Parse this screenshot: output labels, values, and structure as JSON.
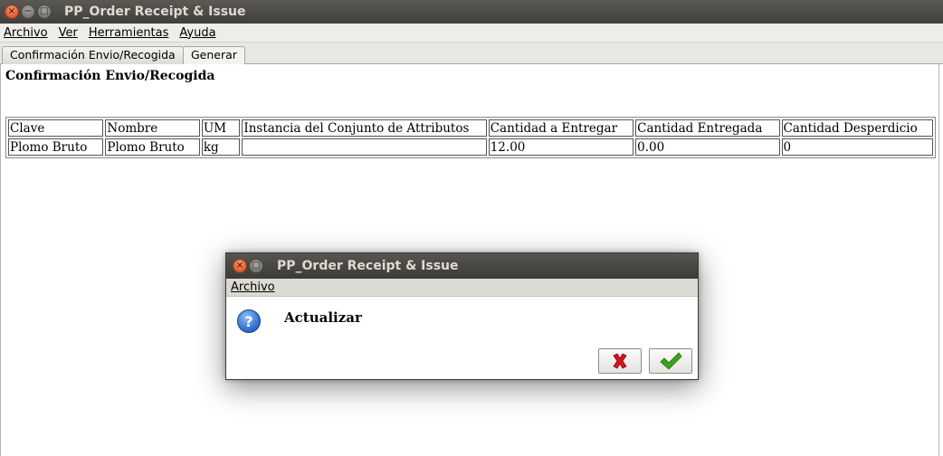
{
  "window": {
    "title": "PP_Order Receipt & Issue"
  },
  "menu": [
    {
      "label": "Archivo"
    },
    {
      "label": "Ver"
    },
    {
      "label": "Herramientas"
    },
    {
      "label": "Ayuda"
    }
  ],
  "tabs": [
    {
      "label": "Confirmación Envio/Recogida",
      "active": false
    },
    {
      "label": "Generar",
      "active": true
    }
  ],
  "section": {
    "title": "Confirmación Envio/Recogida"
  },
  "table": {
    "headers": [
      "Clave",
      "Nombre",
      "UM",
      "Instancia del Conjunto de Attributos",
      "Cantidad a Entregar",
      "Cantidad Entregada",
      "Cantidad Desperdicio"
    ],
    "rows": [
      [
        "Plomo Bruto",
        "Plomo Bruto",
        "kg",
        "",
        "12.00",
        "0.00",
        "0"
      ]
    ]
  },
  "dialog": {
    "title": "PP_Order Receipt & Issue",
    "menu_label": "Archivo",
    "message": "Actualizar",
    "icon": "question-icon",
    "cancel_icon": "red-x-icon",
    "ok_icon": "green-check-icon"
  },
  "colors": {
    "titlebar": "#413f3b",
    "close_button": "#e0582a",
    "cancel_red": "#d8141a",
    "ok_green": "#3aa515"
  }
}
